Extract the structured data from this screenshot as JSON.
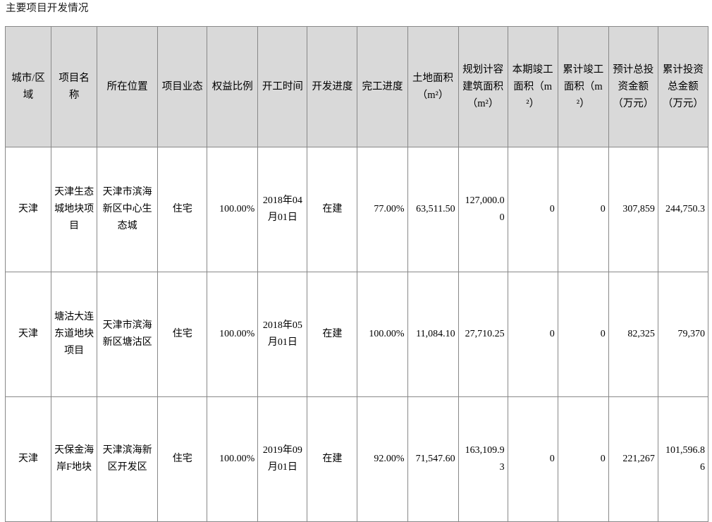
{
  "document": {
    "title": "主要项目开发情况"
  },
  "table": {
    "headers": [
      "城市/区域",
      "项目名称",
      "所在位置",
      "项目业态",
      "权益比例",
      "开工时间",
      "开发进度",
      "完工进度",
      "土地面积（m²）",
      "规划计容建筑面积（m²）",
      "本期竣工面积（m²）",
      "累计竣工面积（m²）",
      "预计总投资金额（万元）",
      "累计投资总金额（万元）"
    ],
    "rows": [
      {
        "city": "天津",
        "project_name": "天津生态城地块项目",
        "location": "天津市滨海新区中心生态城",
        "project_type": "住宅",
        "equity_ratio": "100.00%",
        "start_time": "2018年04月01日",
        "development_progress": "在建",
        "completion_progress": "77.00%",
        "land_area": "63,511.50",
        "planned_gfa": "127,000.00",
        "current_completed_area": "0",
        "cumulative_completed_area": "0",
        "estimated_total_investment": "307,859",
        "cumulative_total_investment": "244,750.3"
      },
      {
        "city": "天津",
        "project_name": "塘沽大连东道地块项目",
        "location": "天津市滨海新区塘沽区",
        "project_type": "住宅",
        "equity_ratio": "100.00%",
        "start_time": "2018年05月01日",
        "development_progress": "在建",
        "completion_progress": "100.00%",
        "land_area": "11,084.10",
        "planned_gfa": "27,710.25",
        "current_completed_area": "0",
        "cumulative_completed_area": "0",
        "estimated_total_investment": "82,325",
        "cumulative_total_investment": "79,370"
      },
      {
        "city": "天津",
        "project_name": "天保金海岸F地块",
        "location": "天津滨海新区开发区",
        "project_type": "住宅",
        "equity_ratio": "100.00%",
        "start_time": "2019年09月01日",
        "development_progress": "在建",
        "completion_progress": "92.00%",
        "land_area": "71,547.60",
        "planned_gfa": "163,109.93",
        "current_completed_area": "0",
        "cumulative_completed_area": "0",
        "estimated_total_investment": "221,267",
        "cumulative_total_investment": "101,596.86"
      }
    ]
  },
  "colors": {
    "header_background": "#d9d9d9",
    "border": "#888888",
    "text": "#000000"
  }
}
